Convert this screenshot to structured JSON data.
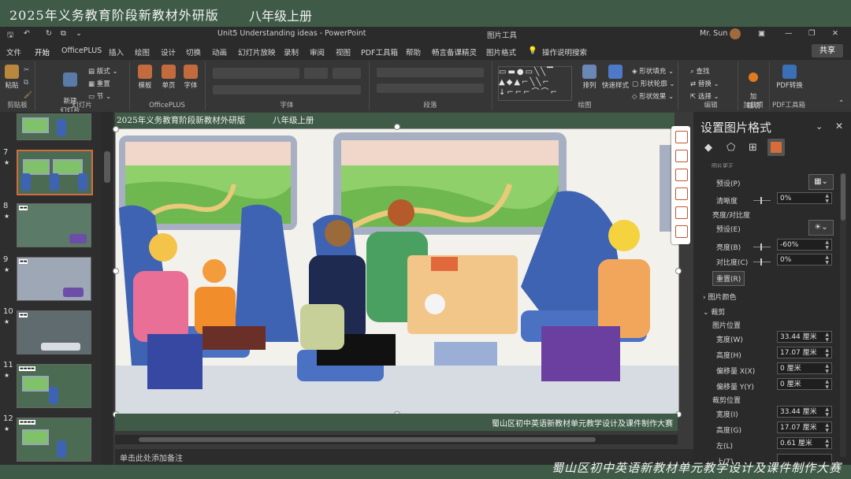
{
  "banner": {
    "title": "2025年义务教育阶段新教材外研版",
    "grade": "八年级上册"
  },
  "titlebar": {
    "doc_title": "Unit5 Understanding ideas  -  PowerPoint",
    "context_tool": "图片工具",
    "user": "Mr. Sun"
  },
  "tabs": [
    "文件",
    "开始",
    "OfficePLUS",
    "插入",
    "绘图",
    "设计",
    "切换",
    "动画",
    "幻灯片放映",
    "录制",
    "审阅",
    "视图",
    "PDF工具箱",
    "帮助",
    "畅言备课精灵",
    "图片格式"
  ],
  "active_tab": "开始",
  "tell_me": "操作说明搜索",
  "share_label": "共享",
  "ribbon": {
    "clipboard": {
      "paste": "粘贴",
      "label": "剪贴板"
    },
    "slides": {
      "new_slide": "新建\n幻灯片",
      "layout": "版式",
      "reset": "重置",
      "section": "节",
      "label": "幻灯片"
    },
    "officeplus": {
      "template": "模板",
      "single": "单页",
      "font": "字体",
      "label": "OfficePLUS"
    },
    "font_label": "字体",
    "paragraph_label": "段落",
    "drawing": {
      "arrange": "排列",
      "quick_styles": "快速样式",
      "fill": "形状填充",
      "outline": "形状轮廓",
      "effects": "形状效果",
      "label": "绘图"
    },
    "editing": {
      "find": "查找",
      "replace": "替换",
      "select": "选择",
      "label": "编辑"
    },
    "addins": {
      "addin": "加\n载项",
      "label": "加载项"
    },
    "pdf": {
      "convert": "PDF转换",
      "label": "PDF工具箱"
    }
  },
  "slide_thumbnails": [
    {
      "num": "",
      "star": ""
    },
    {
      "num": "7",
      "star": "★",
      "selected": true
    },
    {
      "num": "8",
      "star": "★"
    },
    {
      "num": "9",
      "star": "★"
    },
    {
      "num": "10",
      "star": "★"
    },
    {
      "num": "11",
      "star": "★"
    },
    {
      "num": "12",
      "star": "★"
    }
  ],
  "slide": {
    "header_title": "2025年义务教育阶段新教材外研版",
    "header_grade": "八年级上册",
    "footer": "蜀山区初中英语新教材单元教学设计及课件制作大赛"
  },
  "notes_placeholder": "单击此处添加备注",
  "format_pane": {
    "title": "设置图片格式",
    "section_cut": "图片更正",
    "preset": "预设(P)",
    "sharpness": "清晰度",
    "sharpness_val": "0%",
    "bc_header": "亮度/对比度",
    "bc_preset": "预设(E)",
    "brightness": "亮度(B)",
    "brightness_val": "-60%",
    "contrast": "对比度(C)",
    "contrast_val": "0%",
    "reset": "重置(R)",
    "color": "图片颜色",
    "crop": "裁剪",
    "pos_header": "图片位置",
    "width": "宽度(W)",
    "width_val": "33.44 厘米",
    "height": "高度(H)",
    "height_val": "17.07 厘米",
    "offx": "偏移量 X(X)",
    "offx_val": "0 厘米",
    "offy": "偏移量 Y(Y)",
    "offy_val": "0 厘米",
    "crop_header": "裁剪位置",
    "cwidth": "宽度(I)",
    "cwidth_val": "33.44 厘米",
    "cheight": "高度(G)",
    "cheight_val": "17.07 厘米",
    "left": "左(L)",
    "left_val": "0.61 厘米",
    "top": "上(T)"
  },
  "bottom_caption": "蜀山区初中英语新教材单元教学设计及课件制作大赛",
  "colors": {
    "accent": "#c6542f",
    "banner_green": "#3f5b47",
    "seat_blue": "#3f63b3"
  }
}
